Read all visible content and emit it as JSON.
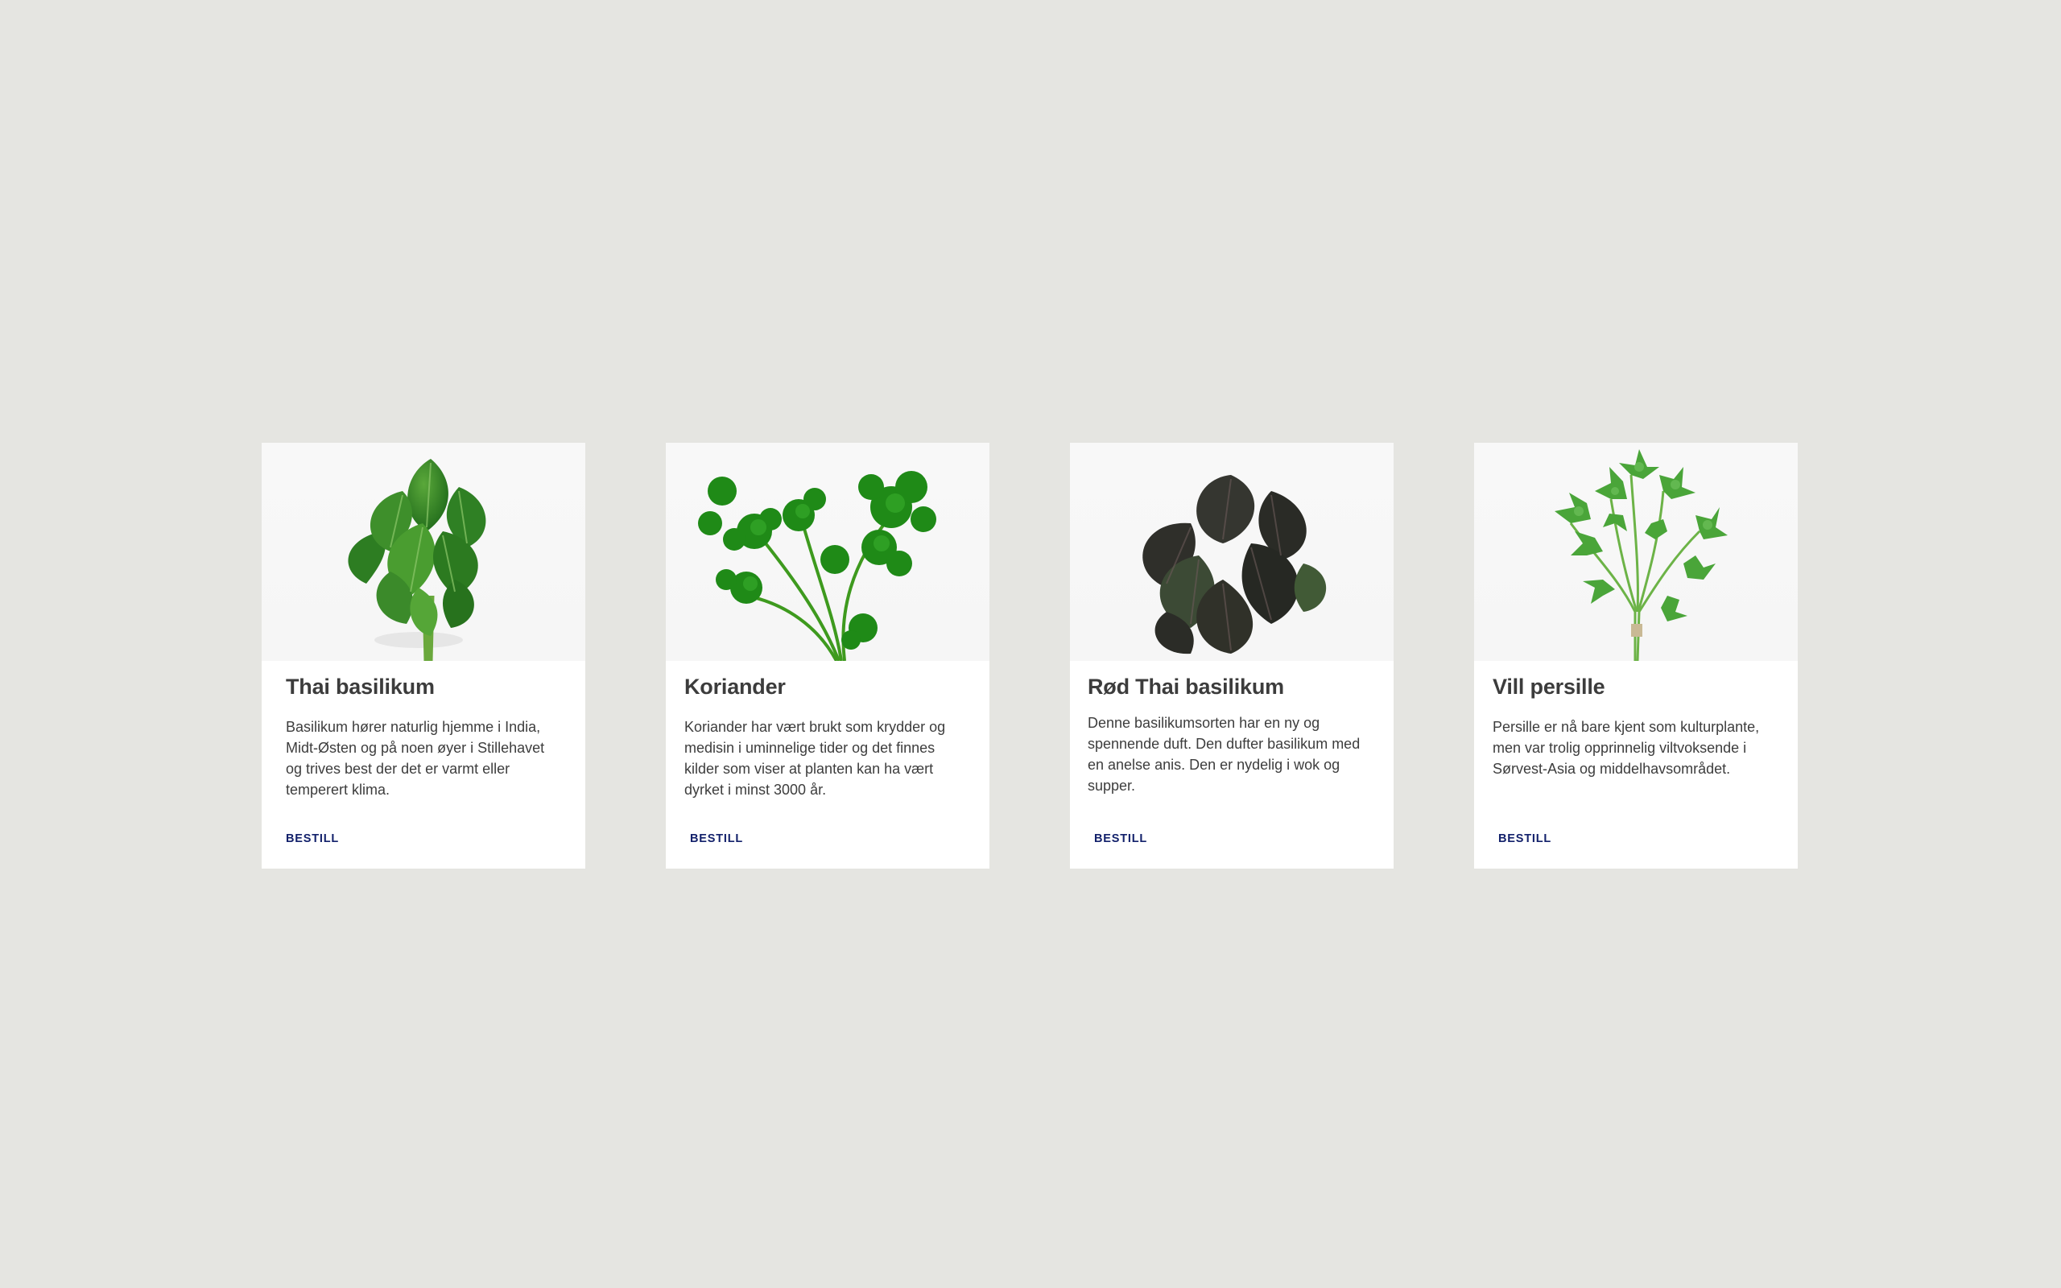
{
  "cards": [
    {
      "title": "Thai basilikum",
      "description": "Basilikum hører naturlig hjemme i India, Midt-Østen og på noen øyer i Stillehavet og trives best der det er varmt eller temperert klima.",
      "cta": "BESTILL",
      "image_icon": "thai-basil-image"
    },
    {
      "title": "Koriander",
      "description": "Koriander har vært brukt som krydder og medisin i uminnelige tider og det finnes kilder som viser at planten kan ha vært dyrket i minst 3000 år.",
      "cta": "BESTILL",
      "image_icon": "coriander-image"
    },
    {
      "title": "Rød Thai basilikum",
      "description": "Denne basilikumsorten har en ny og spennende duft. Den dufter basilikum med en anelse anis. Den er nydelig i wok og supper.",
      "cta": "BESTILL",
      "image_icon": "red-thai-basil-image"
    },
    {
      "title": "Vill persille",
      "description": "Persille er nå bare kjent som kulturplante, men var trolig opprinnelig viltvoksende i Sørvest-Asia og middelhavsområdet.",
      "cta": "BESTILL",
      "image_icon": "wild-parsley-image"
    }
  ],
  "colors": {
    "page_background": "#e5e5e1",
    "card_background": "#ffffff",
    "title_text": "#3c3c3c",
    "body_text": "#3d3d3d",
    "cta_text": "#13216b"
  }
}
